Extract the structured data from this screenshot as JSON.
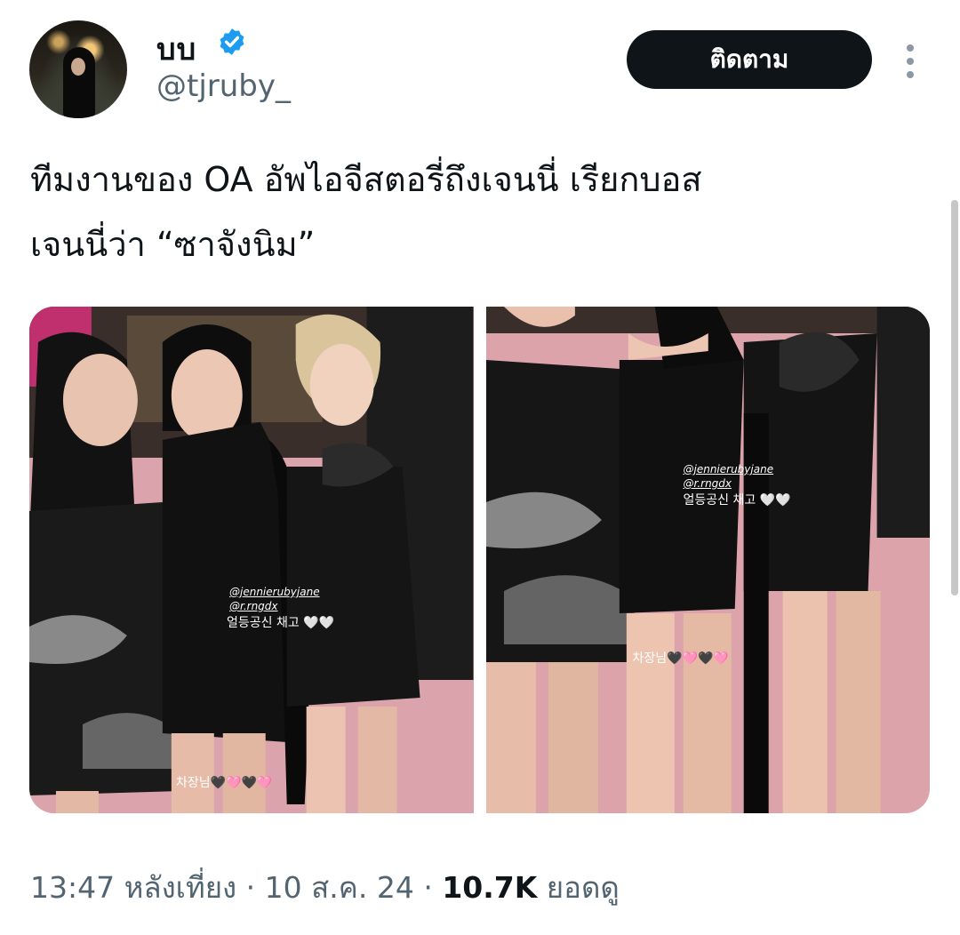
{
  "author": {
    "display_name": "บบ",
    "handle": "@tjruby_",
    "verified": true,
    "avatar_icon": "profile-photo"
  },
  "follow_button": {
    "label": "ติดตาม"
  },
  "more_button": {
    "icon": "more-vertical-icon"
  },
  "tweet": {
    "text_lines": [
      "ทีมงานของ OA อัพไอจีสตอรี่ถึงเจนนี่ เรียกบอส",
      "เจนนี่ว่า “ซาจังนิม”"
    ]
  },
  "media": {
    "photo1": {
      "overlay_handle1": "@jennierubyjane",
      "overlay_handle2": "@r.rngdx",
      "overlay_caption": "얼등공신 채고 🤍🤍",
      "bottom_caption": "차장님🖤🩷🖤🩷"
    },
    "photo2": {
      "overlay_handle1": "@jennierubyjane",
      "overlay_handle2": "@r.rngdx",
      "overlay_caption": "얼등공신 채고 🤍🤍",
      "bottom_caption": "차장님🖤🩷🖤🩷"
    }
  },
  "meta": {
    "time": "13:47 หลังเที่ยง",
    "separator": " · ",
    "date": "10 ส.ค. 24",
    "views_count": "10.7K",
    "views_label": " ยอดดู"
  },
  "colors": {
    "primary_text": "#0f1419",
    "secondary_text": "#536471",
    "verified_blue": "#1d9bf0",
    "follow_bg": "#0f1419"
  }
}
